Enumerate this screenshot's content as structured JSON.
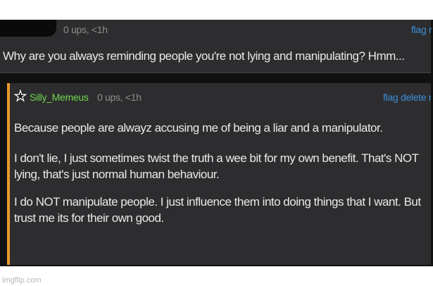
{
  "comment1": {
    "meta": "0 ups, <1h",
    "flag": "flag r",
    "text": "Why are you always reminding people you're not lying and manipulating? Hmm..."
  },
  "comment2": {
    "username": "Silly_Memeus",
    "meta": "0 ups, <1h",
    "actions": "flag delete r",
    "paragraphs": [
      "Because people are alwayz accusing me of being a liar and a manipulator.",
      "I don't lie, I just sometimes twist the truth a wee bit for my own benefit. That's NOT lying, that's just normal human behaviour.",
      "I do NOT manipulate people. I just influence them into doing things that I want. But trust me its for their own good."
    ],
    "star_icon": "star-outline-icon",
    "accent_color": "#e79a2a"
  },
  "watermark": "imgflip.com"
}
